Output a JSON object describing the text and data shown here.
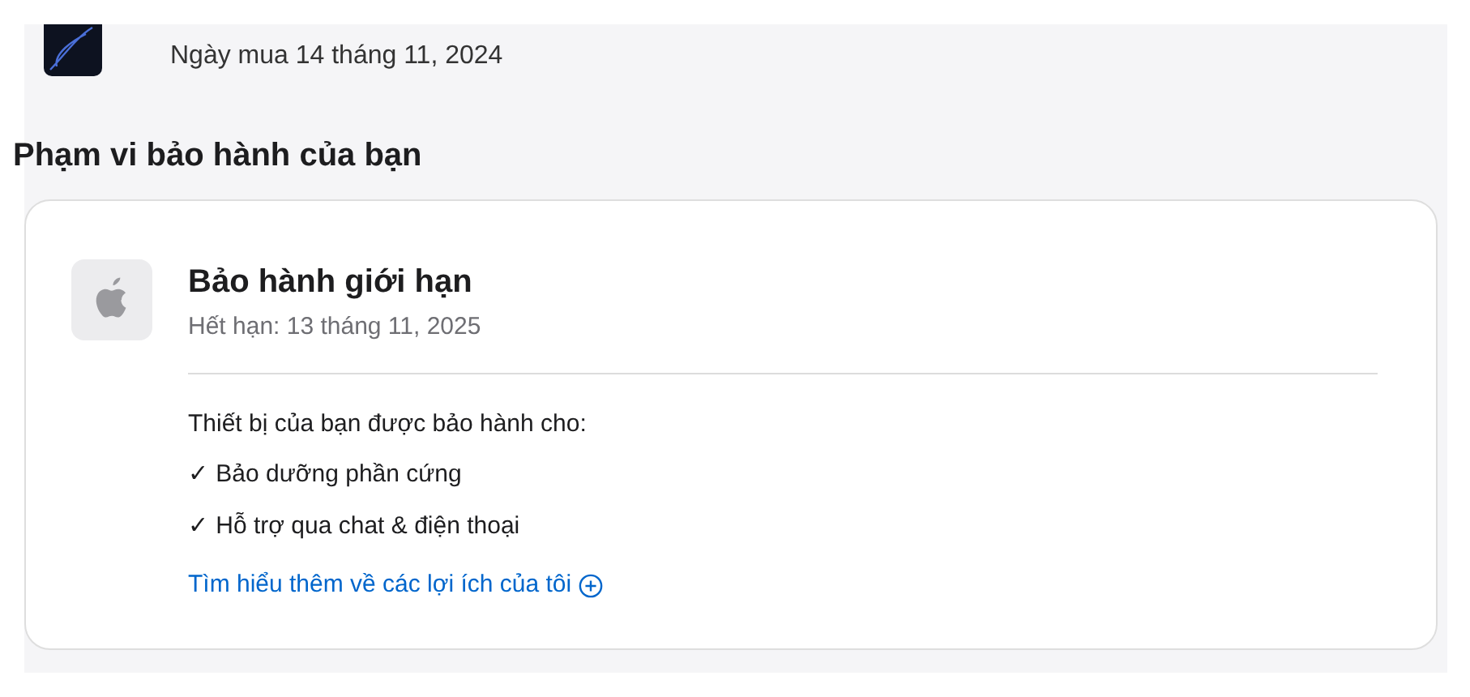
{
  "device": {
    "purchase_date": "Ngày mua 14 tháng 11, 2024"
  },
  "coverage": {
    "heading": "Phạm vi bảo hành của bạn",
    "plan": {
      "title": "Bảo hành giới hạn",
      "expiry": "Hết hạn: 13 tháng 11, 2025"
    },
    "intro": "Thiết bị của bạn được bảo hành cho:",
    "benefits": [
      "✓ Bảo dưỡng phần cứng",
      "✓ Hỗ trợ qua chat & điện thoại"
    ],
    "link": "Tìm hiểu thêm về các lợi ích của tôi"
  }
}
